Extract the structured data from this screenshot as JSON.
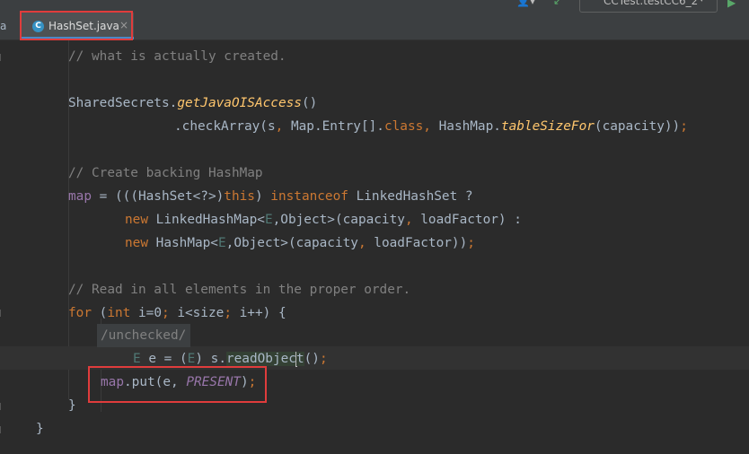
{
  "toolbar": {
    "run_config_label": "CCTest.testCC6_2",
    "run_config_arrow": "▾",
    "user_icon": "👤▾",
    "hammer_icon": "↙",
    "run_icon": "▶"
  },
  "tabs": {
    "previous_tab_fragment": "a",
    "active_tab": {
      "label": "HashSet.java",
      "icon_letter": "C",
      "close": "×"
    }
  },
  "code": {
    "line_comment_what": "// what is actually created.",
    "shared_secrets": "SharedSecrets",
    "dot": ".",
    "get_ois_access": "getJavaOISAccess",
    "parens": "()",
    "check_array_prefix": ".checkArray(s",
    "comma": ",",
    "map_entry": " Map.Entry[].",
    "class_kw": "class",
    "hashmap_dot": " HashMap.",
    "table_size_for": "tableSizeFor",
    "capacity_close": "(capacity))",
    "semicolon": ";",
    "comment_backing": "// Create backing HashMap",
    "map_kw": "map",
    "assign_open": " = (((HashSet<?>)",
    "this_kw": "this",
    "close_paren": ")",
    "instanceof_kw": " instanceof",
    "linked_hash_set_q": " LinkedHashSet ?",
    "new_kw": "new",
    "linked_hash_map": " LinkedHashMap<",
    "type_e": "E",
    "object_generic": ",Object>(capacity",
    "load_factor_colon": " loadFactor) :",
    "hash_map_generic": " HashMap<",
    "load_factor_end": " loadFactor))",
    "comment_read": "// Read in all elements in the proper order.",
    "for_kw": "for",
    "open_paren": " (",
    "int_kw": "int",
    "i_eq_zero": " i=0",
    "i_lt_size": " i<size",
    "i_inc": " i++) {",
    "inspection_hint": "/unchecked/",
    "e_decl": " e = (",
    "s_dot": ") s.",
    "read_object_left": "readObjec",
    "read_object_right": "t",
    "call_end": "()",
    "map_put": ".put(e, ",
    "present": "PRESENT",
    "close_put": ")",
    "close_brace": "}"
  }
}
